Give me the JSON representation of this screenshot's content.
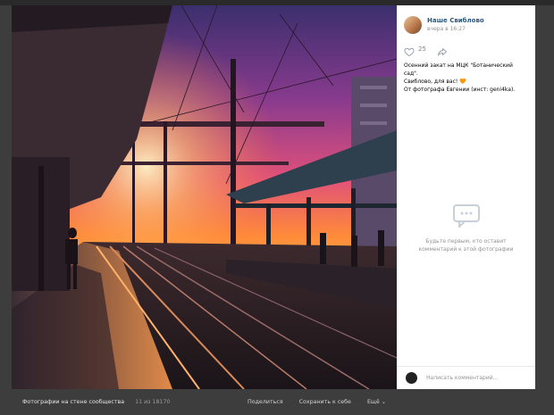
{
  "author": {
    "name": "Наше Свиблово",
    "time": "вчера в 16:27"
  },
  "actions": {
    "likes": "25",
    "like_icon": "heart-outline-icon",
    "share_icon": "share-arrow-icon"
  },
  "caption": {
    "line1": "Осенний закат на МЦК \"Ботанический сад\".",
    "line2": "Свиблово, для вас! 🧡",
    "line3": "От фотографа Евгении (инст: geni4ka)."
  },
  "comments": {
    "empty_line1": "Будьте первым, кто оставит",
    "empty_line2": "комментарий к этой фотографии",
    "icon": "comment-bubble-icon",
    "placeholder": "Написать комментарий..."
  },
  "footer": {
    "album": "Фотографии на стене сообщества",
    "counter": "11 из 18170",
    "share": "Поделиться",
    "save": "Сохранить к себе",
    "more": "Ещё ⌄"
  },
  "colors": {
    "link": "#2a5885",
    "muted": "#939393",
    "accent": "#f58b1d"
  }
}
